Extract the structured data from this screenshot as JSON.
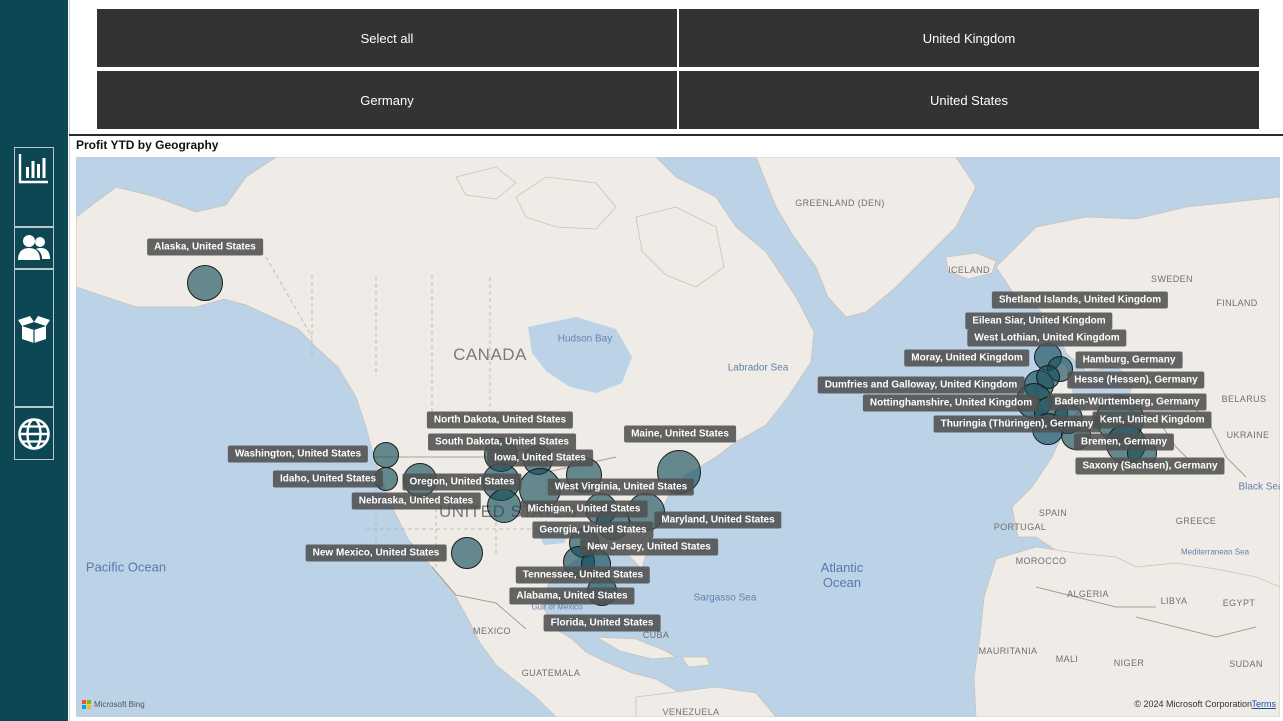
{
  "slicer": {
    "options": [
      "Select all",
      "United Kingdom",
      "Germany",
      "United States"
    ]
  },
  "nav": {
    "items": [
      {
        "icon": "bar-chart-icon"
      },
      {
        "icon": "users-icon"
      },
      {
        "icon": "open-box-icon"
      },
      {
        "icon": "globe-icon"
      }
    ]
  },
  "visual": {
    "title": "Profit YTD by Geography"
  },
  "map": {
    "oceans": [
      {
        "text": "Pacific Ocean"
      },
      {
        "text": "Atlantic\nOcean"
      }
    ],
    "seas": [
      "Hudson Bay",
      "Labrador Sea",
      "Sargasso Sea",
      "Mediterranean Sea",
      "Black Sea",
      "Gulf of Mexico"
    ],
    "big_labels": [
      "CANADA",
      "UNITED STATES"
    ],
    "country_labels": [
      "GREENLAND (DEN)",
      "ICELAND",
      "SWEDEN",
      "FINLAND",
      "BELARUS",
      "UKRAINE",
      "SPAIN",
      "PORTUGAL",
      "MOROCCO",
      "ALGERIA",
      "LIBYA",
      "EGYPT",
      "MAURITANIA",
      "MALI",
      "NIGER",
      "SUDAN",
      "MEXICO",
      "CUBA",
      "GUATEMALA",
      "VENEZUELA",
      "GREECE"
    ],
    "bubbles": [
      {
        "label": "Alaska, United States"
      },
      {
        "label": "Washington, United States"
      },
      {
        "label": "Idaho, United States"
      },
      {
        "label": "Oregon, United States"
      },
      {
        "label": "Nebraska, United States"
      },
      {
        "label": "North Dakota, United States"
      },
      {
        "label": "South Dakota, United States"
      },
      {
        "label": "Iowa, United States"
      },
      {
        "label": "West Virginia, United States"
      },
      {
        "label": "Michigan, United States"
      },
      {
        "label": "Georgia, United States"
      },
      {
        "label": "New Jersey, United States"
      },
      {
        "label": "Maryland, United States"
      },
      {
        "label": "Maine, United States"
      },
      {
        "label": "New Mexico, United States"
      },
      {
        "label": "Tennessee, United States"
      },
      {
        "label": "Alabama, United States"
      },
      {
        "label": "Florida, United States"
      },
      {
        "label": "Shetland Islands, United Kingdom"
      },
      {
        "label": "Eilean Siar, United Kingdom"
      },
      {
        "label": "West Lothian, United Kingdom"
      },
      {
        "label": "Moray, United Kingdom"
      },
      {
        "label": "Hamburg, Germany"
      },
      {
        "label": "Dumfries and Galloway, United Kingdom"
      },
      {
        "label": "Hesse (Hessen), Germany"
      },
      {
        "label": "Nottinghamshire, United Kingdom"
      },
      {
        "label": "Baden-Württemberg, Germany"
      },
      {
        "label": "Kent, United Kingdom"
      },
      {
        "label": "Thuringia (Thüringen), Germany"
      },
      {
        "label": "Bremen, Germany"
      },
      {
        "label": "Saxony (Sachsen), Germany"
      }
    ],
    "attribution": {
      "brand": "Microsoft Bing",
      "copyright": "© 2024 Microsoft Corporation",
      "terms": "Terms"
    }
  },
  "colors": {
    "sidebar": "#0c4753",
    "slicer_button": "#333333",
    "bubble_fill": "#104b57",
    "water": "#bcd2e6",
    "land": "#efece7"
  }
}
